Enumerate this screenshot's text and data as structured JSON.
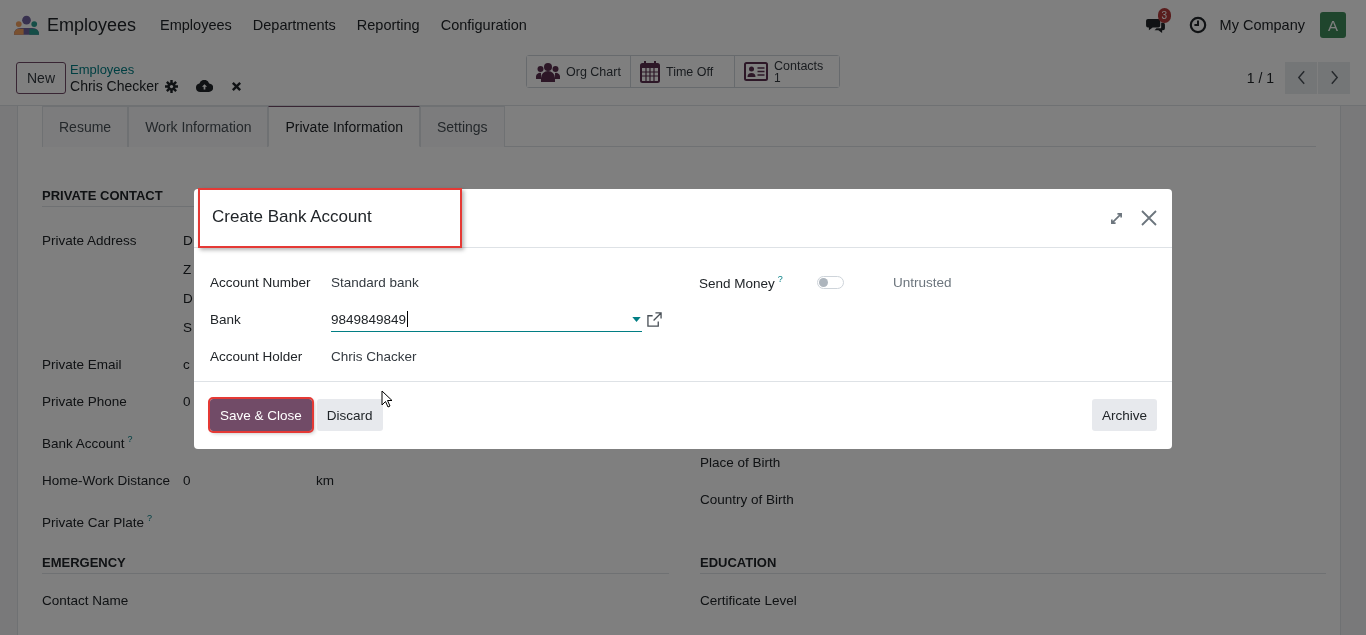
{
  "navbar": {
    "app_name": "Employees",
    "menu": [
      "Employees",
      "Departments",
      "Reporting",
      "Configuration"
    ],
    "messages_badge": "3",
    "company": "My Company",
    "avatar": "A"
  },
  "control_panel": {
    "new_button": "New",
    "breadcrumb": "Employees",
    "record_name": "Chris Checker",
    "pager": "1 / 1",
    "smart_buttons": [
      {
        "kind": "org",
        "label": "Org Chart"
      },
      {
        "kind": "calendar",
        "label": "Time Off"
      },
      {
        "kind": "card",
        "label": "Contacts",
        "count": "1"
      }
    ]
  },
  "tabs": [
    {
      "label": "Resume",
      "selected": false
    },
    {
      "label": "Work Information",
      "selected": false
    },
    {
      "label": "Private Information",
      "selected": true
    },
    {
      "label": "Settings",
      "selected": false
    }
  ],
  "private_contact": {
    "title": "PRIVATE CONTACT",
    "fields": [
      {
        "label": "Private Address",
        "values": [
          "D",
          "Z",
          "D",
          "S"
        ]
      },
      {
        "label": "Private Email",
        "values": [
          "c"
        ]
      },
      {
        "label": "Private Phone",
        "values": [
          "0"
        ]
      },
      {
        "label": "Bank Account",
        "help": "?"
      },
      {
        "label": "Home-Work Distance",
        "values": [
          "0"
        ],
        "unit": "km"
      },
      {
        "label": "Private Car Plate",
        "help": "?"
      }
    ]
  },
  "birth_fields": [
    {
      "label": "Place of Birth"
    },
    {
      "label": "Country of Birth"
    }
  ],
  "emergency": {
    "title": "EMERGENCY",
    "fields": [
      {
        "label": "Contact Name"
      }
    ]
  },
  "education": {
    "title": "EDUCATION",
    "fields": [
      {
        "label": "Certificate Level"
      }
    ]
  },
  "dialog": {
    "title": "Create Bank Account",
    "title_highlighted": true,
    "fields": [
      {
        "kind": "text",
        "label": "Account Number",
        "value": "Standard bank"
      },
      {
        "kind": "many2one",
        "label": "Bank",
        "value": "9849849849"
      },
      {
        "kind": "text",
        "label": "Account Holder",
        "value": "Chris Chacker"
      }
    ],
    "send_money": {
      "label": "Send Money",
      "help": "?",
      "on": false,
      "status": "Untrusted"
    },
    "buttons": [
      {
        "kind": "primary",
        "label": "Save & Close",
        "highlighted": true
      },
      {
        "kind": "secondary",
        "label": "Discard",
        "highlighted": false
      },
      {
        "kind": "archive",
        "label": "Archive",
        "highlighted": false
      }
    ]
  }
}
